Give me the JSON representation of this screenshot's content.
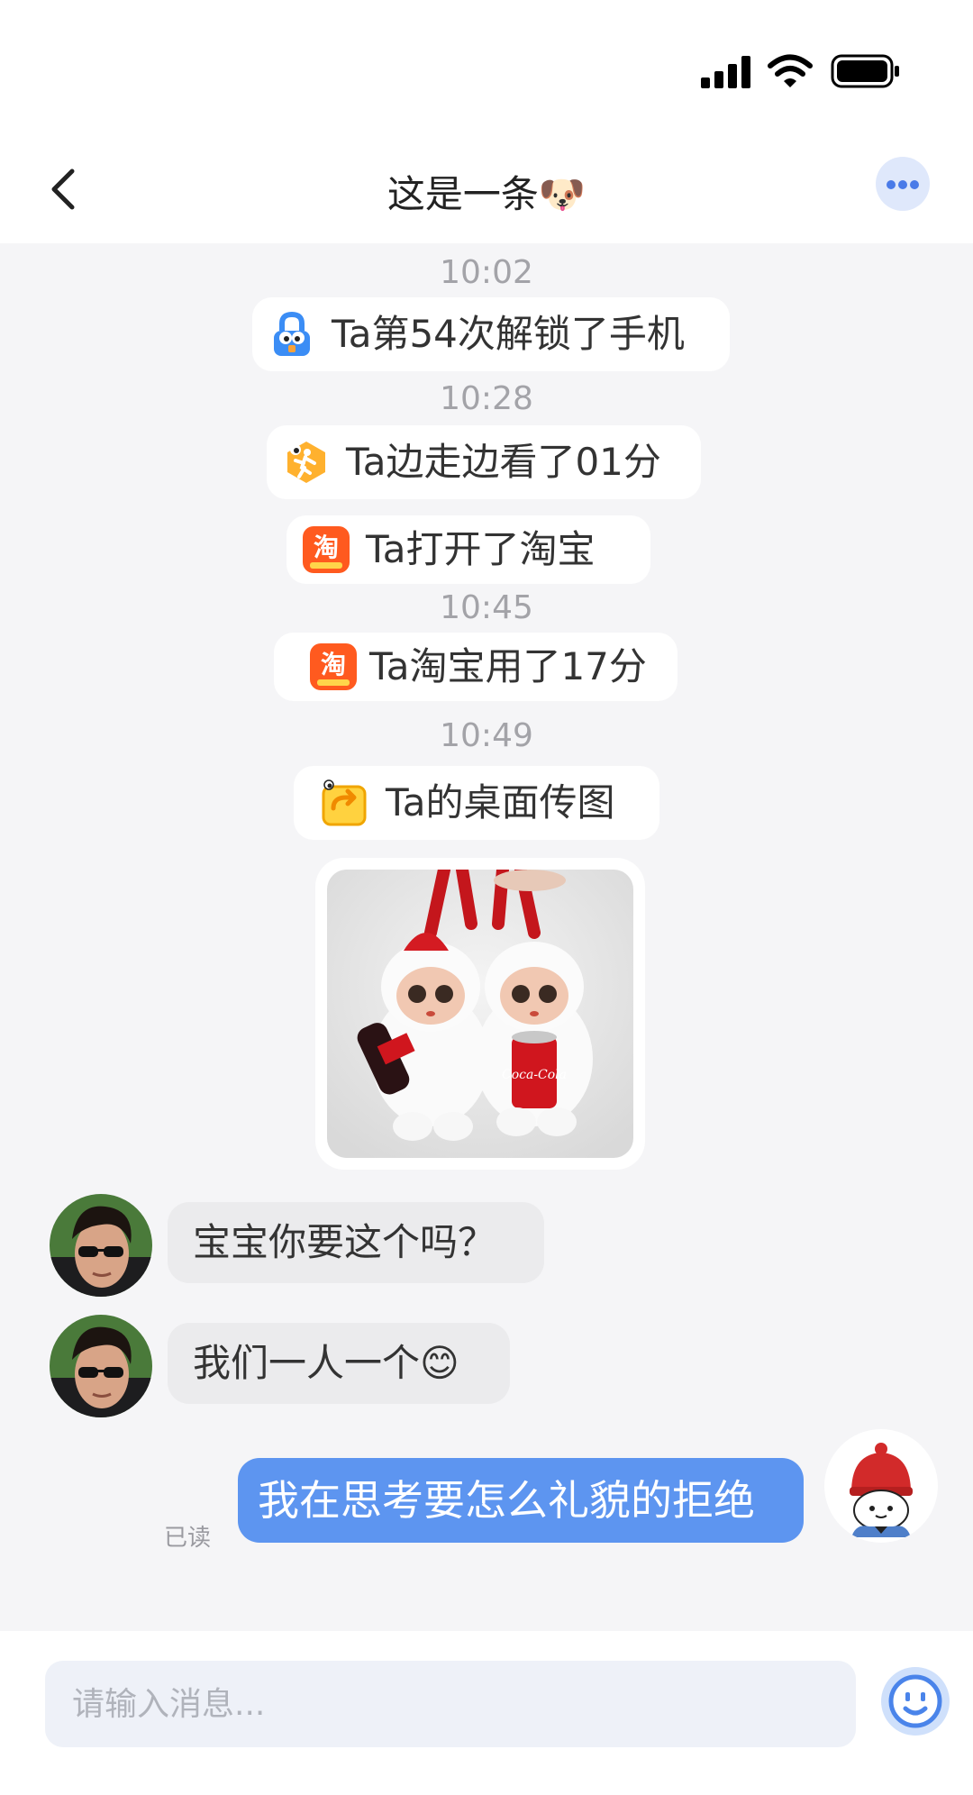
{
  "header": {
    "title": "这是一条🐶"
  },
  "timeline": [
    {
      "time": "10:02",
      "events": [
        {
          "icon": "lock-app-icon",
          "text": "Ta第54次解锁了手机"
        }
      ]
    },
    {
      "time": "10:28",
      "events": [
        {
          "icon": "walking-app-icon",
          "text": "Ta边走边看了01分"
        },
        {
          "icon": "taobao-icon",
          "text": "Ta打开了淘宝"
        }
      ]
    },
    {
      "time": "10:45",
      "events": [
        {
          "icon": "taobao-icon",
          "text": "Ta淘宝用了17分"
        }
      ]
    },
    {
      "time": "10:49",
      "events": [
        {
          "icon": "share-screen-icon",
          "text": "Ta的桌面传图"
        }
      ]
    }
  ],
  "shared_image": {
    "label": "Coca-Cola"
  },
  "messages": [
    {
      "from": "other",
      "text": "宝宝你要这个吗？"
    },
    {
      "from": "other",
      "text": "我们一人一个😊"
    },
    {
      "from": "me",
      "text": "我在思考要怎么礼貌的拒绝",
      "status": "已读"
    }
  ],
  "composer": {
    "placeholder": "请输入消息..."
  },
  "colors": {
    "accent": "#5d95f0",
    "taobao": "#ff5a1f",
    "background": "#f5f5f7"
  }
}
